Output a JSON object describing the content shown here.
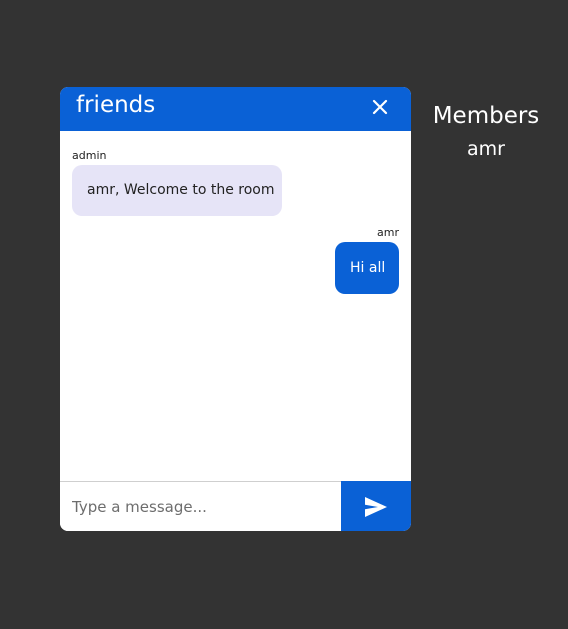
{
  "chat": {
    "room_name": "friends",
    "close_icon": "close-icon",
    "messages": [
      {
        "sender": "admin",
        "text": "amr, Welcome to the room",
        "direction": "incoming"
      },
      {
        "sender": "amr",
        "text": "Hi all",
        "direction": "outgoing"
      }
    ],
    "input_placeholder": "Type a message...",
    "input_value": "",
    "send_icon": "send-icon"
  },
  "members": {
    "title": "Members",
    "list": [
      "amr"
    ]
  },
  "colors": {
    "background": "#333333",
    "accent": "#0a61d6",
    "incoming_bubble": "#e6e4f7",
    "panel": "#ffffff"
  }
}
